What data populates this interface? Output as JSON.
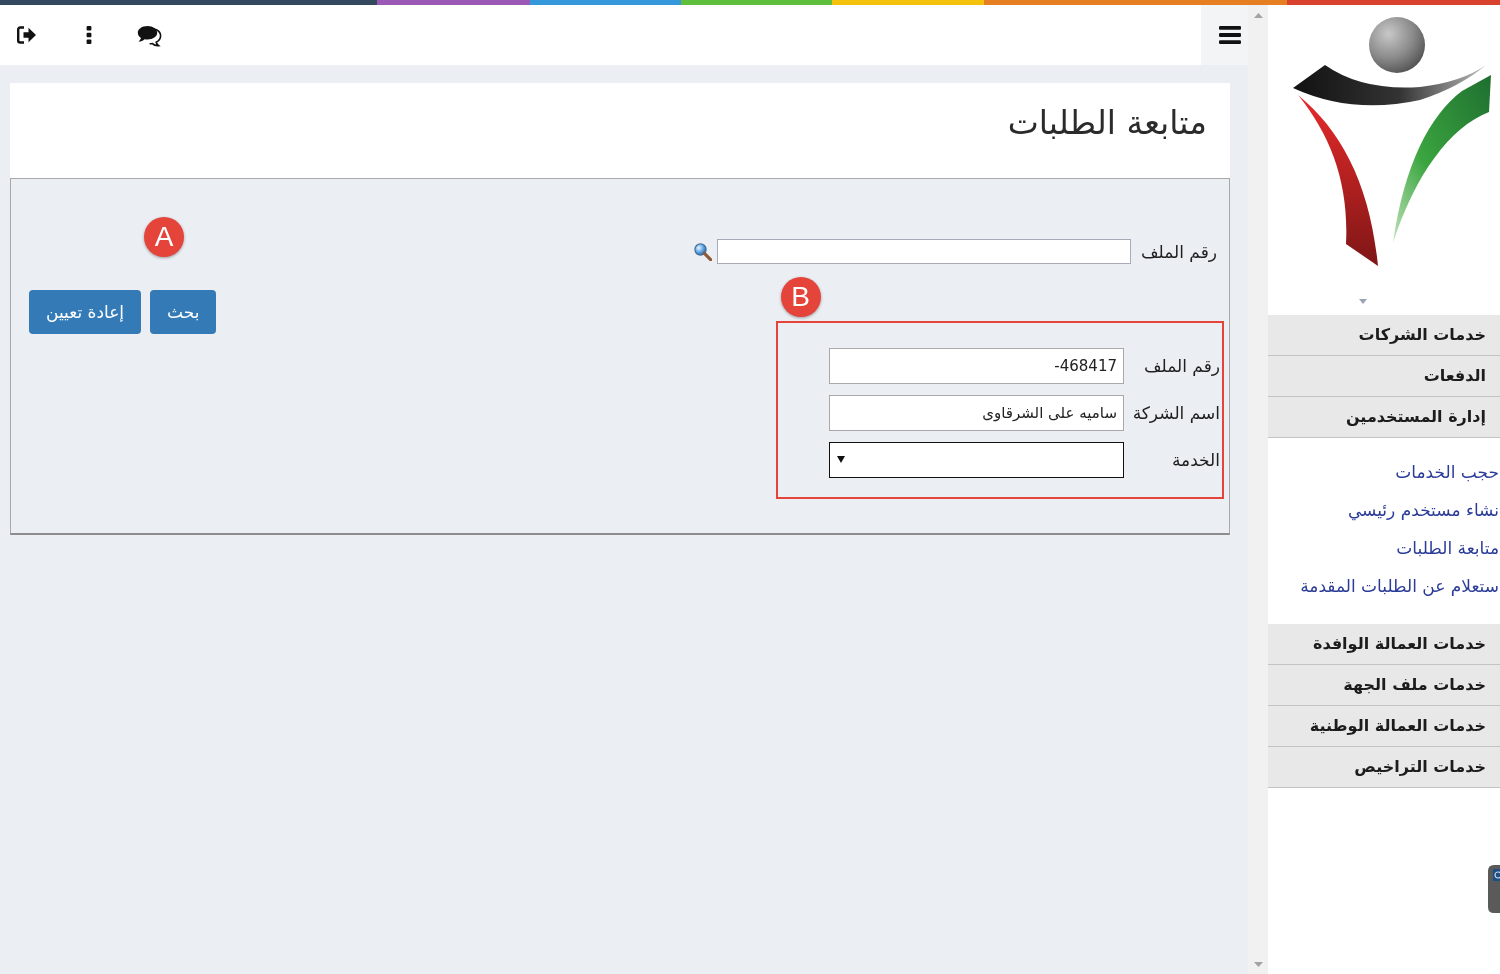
{
  "page_title": "متابعة الطلبات",
  "search": {
    "label": "رقم الملف"
  },
  "actions": {
    "marker": "A",
    "buttons": [
      {
        "label": "بحث"
      },
      {
        "label": "إعادة تعيين"
      }
    ]
  },
  "details": {
    "marker": "B",
    "fields": [
      {
        "kind": "text",
        "label": "رقم الملف",
        "value": "-468417"
      },
      {
        "kind": "text",
        "label": "اسم الشركة",
        "value": "ساميه على الشرقاوى"
      },
      {
        "kind": "select",
        "label": "الخدمة"
      }
    ]
  },
  "sidebar": {
    "items": [
      {
        "label": "خدمات الشركات"
      },
      {
        "label": "الدفعات"
      },
      {
        "label": "إدارة المستخدمين",
        "expanded": true,
        "children": [
          {
            "label": "حجب الخدمات"
          },
          {
            "label": "نشاء مستخدم رئيسي"
          },
          {
            "label": "متابعة الطلبات"
          },
          {
            "label": "ستعلام عن الطلبات المقدمة"
          }
        ]
      },
      {
        "label": "خدمات العمالة الوافدة"
      },
      {
        "label": "خدمات ملف الجهة"
      },
      {
        "label": "خدمات العمالة الوطنية"
      },
      {
        "label": "خدمات التراخيص"
      }
    ]
  }
}
